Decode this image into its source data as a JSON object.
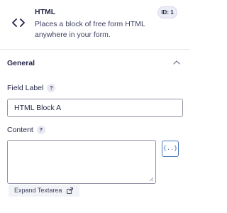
{
  "block": {
    "icon": "code-icon",
    "title": "HTML",
    "description": "Places a block of free form HTML anywhere in your form.",
    "id_badge": "ID: 1"
  },
  "section": {
    "title": "General",
    "toggle_icon": "chevron-up-icon",
    "expanded": true
  },
  "fields": {
    "field_label": {
      "label": "Field Label",
      "help_icon": "?",
      "value": "HTML Block A"
    },
    "content": {
      "label": "Content",
      "help_icon": "?",
      "value": "",
      "merge_tag_button": "{..}",
      "expand_label": "Expand Textarea",
      "expand_icon": "external-link-icon"
    }
  },
  "colors": {
    "text": "#242748",
    "input_border": "#9091a6",
    "accent": "#3a64b0",
    "badge_bg": "#ebecf5"
  }
}
